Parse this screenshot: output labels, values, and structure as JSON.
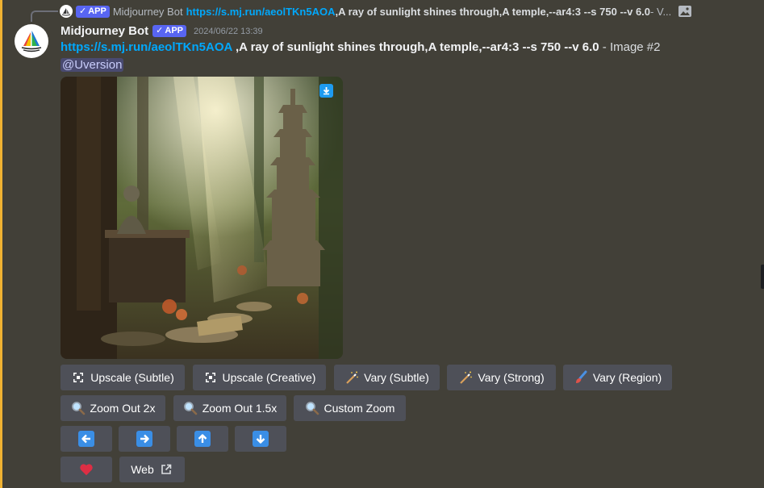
{
  "reply": {
    "author": "Midjourney Bot",
    "badge": "APP",
    "link": "https://s.mj.run/aeolTKn5AOA",
    "prompt": " ,A ray of sunlight shines through,A temple,--ar4:3 --s 750 --v 6.0",
    "trail": " - V..."
  },
  "message": {
    "author": "Midjourney Bot",
    "badge": "APP",
    "timestamp": "2024/06/22 13:39",
    "link": "https://s.mj.run/aeolTKn5AOA",
    "prompt": " ,A ray of sunlight shines through,A temple,--ar4:3 --s 750 --v 6.0",
    "suffix": " - Image #2",
    "mention": "@Uversion"
  },
  "buttons": {
    "row1": [
      {
        "label": "Upscale (Subtle)",
        "icon": "upscale-icon"
      },
      {
        "label": "Upscale (Creative)",
        "icon": "upscale-icon"
      },
      {
        "label": "Vary (Subtle)",
        "icon": "magic-wand-icon"
      },
      {
        "label": "Vary (Strong)",
        "icon": "magic-wand-icon"
      },
      {
        "label": "Vary (Region)",
        "icon": "paintbrush-icon"
      }
    ],
    "row2": [
      {
        "label": "Zoom Out 2x",
        "icon": "magnifier-icon"
      },
      {
        "label": "Zoom Out 1.5x",
        "icon": "magnifier-icon"
      },
      {
        "label": "Custom Zoom",
        "icon": "magnifier-icon"
      }
    ],
    "row3": [
      {
        "icon": "arrow-left-icon"
      },
      {
        "icon": "arrow-right-icon"
      },
      {
        "icon": "arrow-up-icon"
      },
      {
        "icon": "arrow-down-icon"
      }
    ],
    "row4": [
      {
        "icon": "heart-icon"
      },
      {
        "label": "Web",
        "icon": "external-link-icon"
      }
    ]
  },
  "colors": {
    "background": "#424038",
    "highlight": "#f0b232",
    "link": "#00a8fc",
    "badge": "#5865f2",
    "button": "#4e5058",
    "arrow": "#3a8ee6",
    "heart": "#dd2e44"
  }
}
